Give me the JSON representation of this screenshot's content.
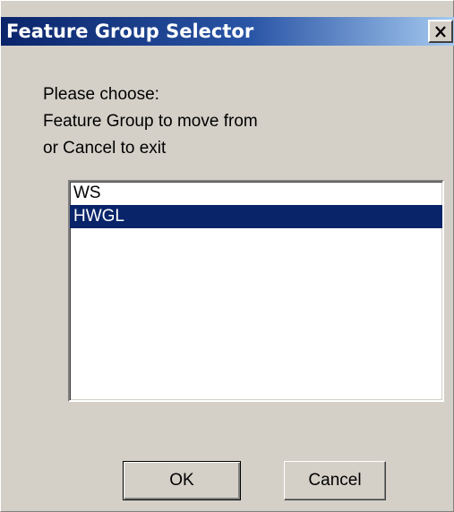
{
  "dialog": {
    "title": "Feature Group Selector",
    "close_icon": "close-icon"
  },
  "prompt": {
    "lines": [
      "Please choose:",
      "Feature Group to move from",
      "or Cancel to exit"
    ]
  },
  "list": {
    "items": [
      "WS",
      "HWGL"
    ],
    "selected_index": 1
  },
  "buttons": {
    "ok_label": "OK",
    "cancel_label": "Cancel"
  },
  "colors": {
    "titlebar_start": "#0a246a",
    "titlebar_end": "#a6caf0",
    "selection": "#0a246a",
    "face": "#d4d0c8"
  }
}
